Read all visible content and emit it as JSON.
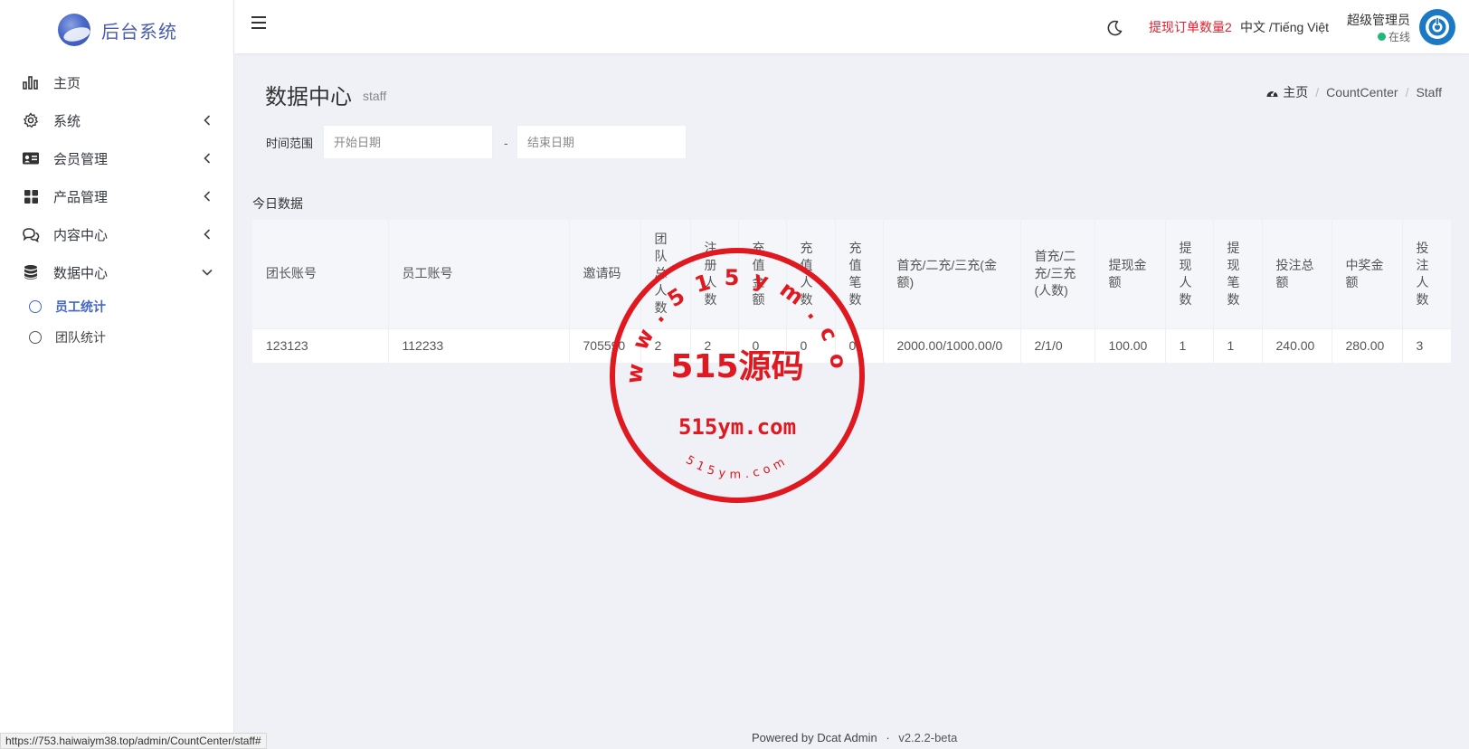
{
  "brand": {
    "name": "后台系统"
  },
  "sidebar": {
    "items": [
      {
        "label": "主页"
      },
      {
        "label": "系统"
      },
      {
        "label": "会员管理"
      },
      {
        "label": "产品管理"
      },
      {
        "label": "内容中心"
      },
      {
        "label": "数据中心"
      }
    ],
    "subitems": [
      {
        "label": "员工统计",
        "active": true
      },
      {
        "label": "团队统计",
        "active": false
      }
    ]
  },
  "topbar": {
    "alert": "提现订单数量2",
    "language": "中文 /Tiếng Việt",
    "user_name": "超级管理员",
    "user_status": "在线",
    "status_color": "#21b978"
  },
  "page": {
    "title": "数据中心",
    "subtitle": "staff",
    "breadcrumb": {
      "home": "主页",
      "mid": "CountCenter",
      "current": "Staff"
    }
  },
  "filter": {
    "label": "时间范围",
    "start_placeholder": "开始日期",
    "separator": "-",
    "end_placeholder": "结束日期"
  },
  "table": {
    "title": "今日数据",
    "columns": [
      "团长账号",
      "员工账号",
      "邀请码",
      "团队总人数",
      "注册人数",
      "充值金额",
      "充值人数",
      "充值笔数",
      "首充/二充/三充(金额)",
      "首充/二充/三充(人数)",
      "提现金额",
      "提现人数",
      "提现笔数",
      "投注总额",
      "中奖金额",
      "投注人数"
    ],
    "rows": [
      [
        "123123",
        "112233",
        "705590",
        "2",
        "2",
        "0",
        "0",
        "0",
        "2000.00/1000.00/0",
        "2/1/0",
        "100.00",
        "1",
        "1",
        "240.00",
        "280.00",
        "3"
      ]
    ]
  },
  "footer": {
    "powered": "Powered by Dcat Admin",
    "dot": "·",
    "version": "v2.2.2-beta"
  },
  "status_url": "https://753.haiwaiym38.top/admin/CountCenter/staff#",
  "watermark": {
    "ring_text": "www.515ym.com",
    "center_text": "515源码",
    "domain": "515ym.com",
    "small_text": "515ym.com",
    "color": "#e01820"
  }
}
